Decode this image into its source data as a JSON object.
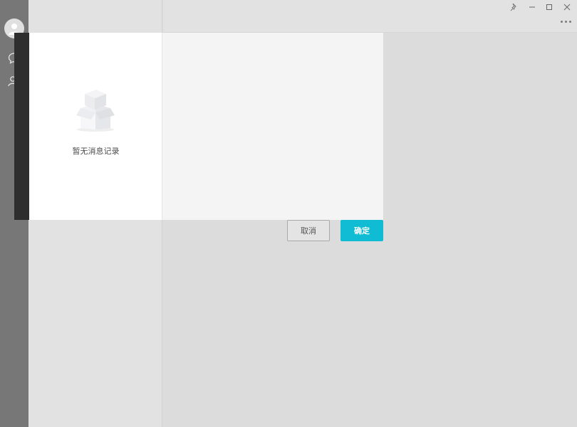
{
  "sidebar": {
    "icons": [
      "avatar-icon",
      "chat-bubble-icon",
      "contacts-icon"
    ]
  },
  "titlebar": {
    "icons": [
      "pin-icon",
      "minimize-icon",
      "maximize-icon",
      "close-icon",
      "more-icon"
    ]
  },
  "dialog": {
    "empty_text": "暂无消息记录",
    "cancel_label": "取消",
    "ok_label": "确定"
  },
  "colors": {
    "accent": "#0fbcd4",
    "sidebar_bg": "#777777",
    "overlay_strip": "#2e2e2e"
  }
}
